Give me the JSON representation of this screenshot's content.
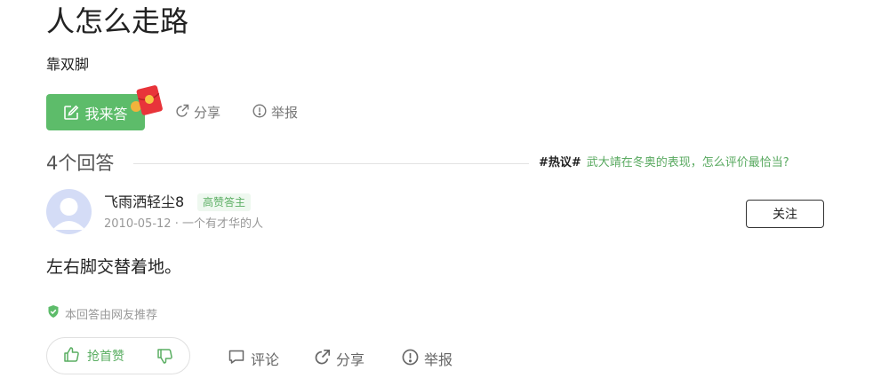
{
  "question": {
    "title": "人怎么走路",
    "description": "靠双脚"
  },
  "question_actions": {
    "answer_label": "我来答",
    "share_label": "分享",
    "report_label": "举报"
  },
  "answers_header": {
    "count_label": "4个回答",
    "hot_tag": "#热议#",
    "hot_topic": "武大靖在冬奥的表现，怎么评价最恰当?"
  },
  "answer": {
    "author": "飞雨洒轻尘8",
    "badge": "高赞答主",
    "date": "2010-05-12",
    "separator": "·",
    "author_desc": "一个有才华的人",
    "follow_label": "关注",
    "text": "左右脚交替着地。",
    "recommend_note": "本回答由网友推荐"
  },
  "answer_actions": {
    "upvote_label": "抢首赞",
    "comment_label": "评论",
    "share_label": "分享",
    "report_label": "举报"
  },
  "colors": {
    "accent_green": "#5dbc6a",
    "badge_bg": "#eef8ef",
    "red_packet": "#e8343a"
  }
}
